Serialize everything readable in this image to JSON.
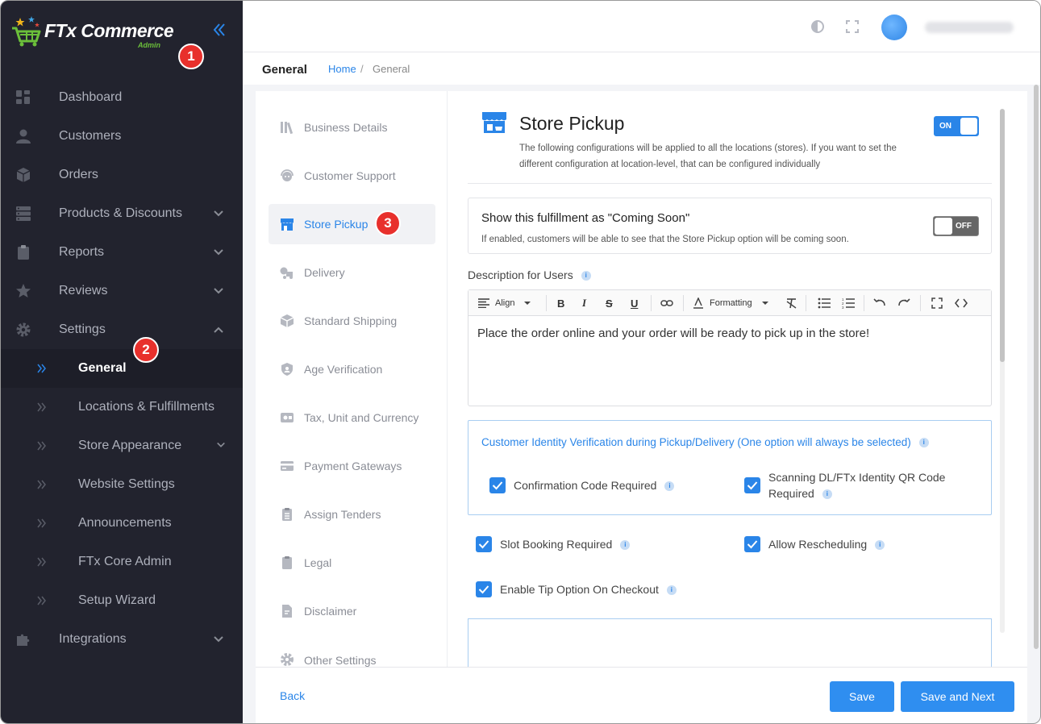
{
  "brand": {
    "name": "FTx Commerce",
    "sub": "Admin"
  },
  "badges": {
    "one": "1",
    "two": "2",
    "three": "3"
  },
  "sidebar": {
    "items": [
      {
        "label": "Dashboard",
        "icon": "dashboard-icon"
      },
      {
        "label": "Customers",
        "icon": "user-icon"
      },
      {
        "label": "Orders",
        "icon": "box-icon"
      },
      {
        "label": "Products & Discounts",
        "icon": "server-icon"
      },
      {
        "label": "Reports",
        "icon": "clipboard-icon"
      },
      {
        "label": "Reviews",
        "icon": "star-icon"
      },
      {
        "label": "Settings",
        "icon": "gear-icon"
      }
    ],
    "sub_items": [
      {
        "label": "General"
      },
      {
        "label": "Locations & Fulfillments"
      },
      {
        "label": "Store Appearance"
      },
      {
        "label": "Website Settings"
      },
      {
        "label": "Announcements"
      },
      {
        "label": "FTx Core Admin"
      },
      {
        "label": "Setup Wizard"
      }
    ],
    "integrations": "Integrations"
  },
  "header": {
    "title": "General",
    "crumb_home": "Home",
    "crumb_sep": "/",
    "crumb_current": "General"
  },
  "subnav": [
    {
      "label": "Business Details"
    },
    {
      "label": "Customer Support"
    },
    {
      "label": "Store Pickup"
    },
    {
      "label": "Delivery"
    },
    {
      "label": "Standard Shipping"
    },
    {
      "label": "Age Verification"
    },
    {
      "label": "Tax, Unit and Currency"
    },
    {
      "label": "Payment Gateways"
    },
    {
      "label": "Assign Tenders"
    },
    {
      "label": "Legal"
    },
    {
      "label": "Disclaimer"
    },
    {
      "label": "Other Settings"
    }
  ],
  "store_pickup": {
    "title": "Store Pickup",
    "description": "The following configurations will be applied to all the locations (stores). If you want to set the different configuration at location-level, that can be configured individually",
    "toggle": "ON",
    "coming_soon": {
      "title": "Show this fulfillment as \"Coming Soon\"",
      "description": "If enabled, customers will be able to see that the Store Pickup option will be coming soon.",
      "toggle": "OFF"
    },
    "desc_label": "Description for Users",
    "editor": {
      "align": "Align",
      "formatting": "Formatting",
      "content": "Place the order online and your order will be ready to pick up in the store!"
    },
    "identity": {
      "title": "Customer Identity Verification during Pickup/Delivery (One option will always be selected)",
      "opt1": "Confirmation Code Required",
      "opt2_line1": "Scanning DL/FTx Identity QR Code",
      "opt2_line2": "Required"
    },
    "slot_booking": "Slot Booking Required",
    "rescheduling": "Allow Rescheduling",
    "tip": "Enable Tip Option On Checkout",
    "info": "i"
  },
  "footer": {
    "back": "Back",
    "save": "Save",
    "save_next": "Save and Next"
  },
  "colors": {
    "accent": "#2a85e8",
    "sidebar": "#22232e",
    "badge": "#e8302c"
  }
}
